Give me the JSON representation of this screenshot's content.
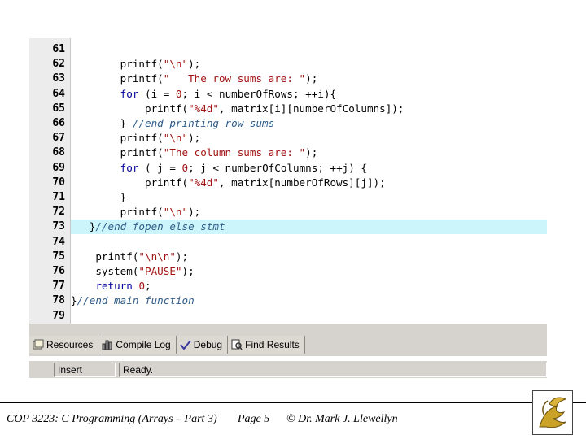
{
  "editor": {
    "lines": [
      {
        "number": "61",
        "tokens": [
          {
            "t": "",
            "c": "tok-punct"
          }
        ]
      },
      {
        "number": "62",
        "tokens": [
          {
            "t": "        printf(",
            "c": "tok-fn"
          },
          {
            "t": "\"\\n\"",
            "c": "tok-str"
          },
          {
            "t": ");",
            "c": "tok-punct"
          }
        ]
      },
      {
        "number": "63",
        "tokens": [
          {
            "t": "        printf(",
            "c": "tok-fn"
          },
          {
            "t": "\"   The row sums are: \"",
            "c": "tok-str"
          },
          {
            "t": ");",
            "c": "tok-punct"
          }
        ]
      },
      {
        "number": "64",
        "tokens": [
          {
            "t": "        ",
            "c": "tok-punct"
          },
          {
            "t": "for",
            "c": "tok-kw"
          },
          {
            "t": " (i = ",
            "c": "tok-punct"
          },
          {
            "t": "0",
            "c": "tok-num"
          },
          {
            "t": "; i < numberOfRows; ++i){",
            "c": "tok-punct"
          }
        ]
      },
      {
        "number": "65",
        "tokens": [
          {
            "t": "            printf(",
            "c": "tok-fn"
          },
          {
            "t": "\"%4d\"",
            "c": "tok-str"
          },
          {
            "t": ", matrix[i][numberOfColumns]);",
            "c": "tok-punct"
          }
        ]
      },
      {
        "number": "66",
        "tokens": [
          {
            "t": "        } ",
            "c": "tok-punct"
          },
          {
            "t": "//end printing row sums",
            "c": "tok-com"
          }
        ]
      },
      {
        "number": "67",
        "tokens": [
          {
            "t": "        printf(",
            "c": "tok-fn"
          },
          {
            "t": "\"\\n\"",
            "c": "tok-str"
          },
          {
            "t": ");",
            "c": "tok-punct"
          }
        ]
      },
      {
        "number": "68",
        "tokens": [
          {
            "t": "        printf(",
            "c": "tok-fn"
          },
          {
            "t": "\"The column sums are: \"",
            "c": "tok-str"
          },
          {
            "t": ");",
            "c": "tok-punct"
          }
        ]
      },
      {
        "number": "69",
        "tokens": [
          {
            "t": "        ",
            "c": "tok-punct"
          },
          {
            "t": "for",
            "c": "tok-kw"
          },
          {
            "t": " ( j = ",
            "c": "tok-punct"
          },
          {
            "t": "0",
            "c": "tok-num"
          },
          {
            "t": "; j < numberOfColumns; ++j) {",
            "c": "tok-punct"
          }
        ]
      },
      {
        "number": "70",
        "tokens": [
          {
            "t": "            printf(",
            "c": "tok-fn"
          },
          {
            "t": "\"%4d\"",
            "c": "tok-str"
          },
          {
            "t": ", matrix[numberOfRows][j]);",
            "c": "tok-punct"
          }
        ]
      },
      {
        "number": "71",
        "tokens": [
          {
            "t": "        }",
            "c": "tok-punct"
          }
        ]
      },
      {
        "number": "72",
        "tokens": [
          {
            "t": "        printf(",
            "c": "tok-fn"
          },
          {
            "t": "\"\\n\"",
            "c": "tok-str"
          },
          {
            "t": ");",
            "c": "tok-punct"
          }
        ]
      },
      {
        "number": "73",
        "highlighted": true,
        "tokens": [
          {
            "t": "   }",
            "c": "tok-punct"
          },
          {
            "t": "//end fopen else stmt",
            "c": "tok-com"
          }
        ]
      },
      {
        "number": "74",
        "tokens": [
          {
            "t": "",
            "c": "tok-punct"
          }
        ]
      },
      {
        "number": "75",
        "tokens": [
          {
            "t": "    printf(",
            "c": "tok-fn"
          },
          {
            "t": "\"\\n\\n\"",
            "c": "tok-str"
          },
          {
            "t": ");",
            "c": "tok-punct"
          }
        ]
      },
      {
        "number": "76",
        "tokens": [
          {
            "t": "    system(",
            "c": "tok-fn"
          },
          {
            "t": "\"PAUSE\"",
            "c": "tok-str"
          },
          {
            "t": ");",
            "c": "tok-punct"
          }
        ]
      },
      {
        "number": "77",
        "tokens": [
          {
            "t": "    ",
            "c": "tok-punct"
          },
          {
            "t": "return",
            "c": "tok-kw"
          },
          {
            "t": " ",
            "c": "tok-punct"
          },
          {
            "t": "0",
            "c": "tok-num"
          },
          {
            "t": ";",
            "c": "tok-punct"
          }
        ]
      },
      {
        "number": "78",
        "tokens": [
          {
            "t": "}",
            "c": "tok-punct"
          },
          {
            "t": "//end main function",
            "c": "tok-com"
          }
        ]
      },
      {
        "number": "79",
        "tokens": [
          {
            "t": "",
            "c": "tok-punct"
          }
        ]
      }
    ],
    "highlight_color": "#ccf5fb"
  },
  "bottom_tabs": [
    {
      "label": "Resources",
      "icon": "resources-icon"
    },
    {
      "label": "Compile Log",
      "icon": "compile-log-icon"
    },
    {
      "label": "Debug",
      "icon": "debug-icon"
    },
    {
      "label": "Find Results",
      "icon": "find-results-icon"
    }
  ],
  "status_bar": {
    "mode": "Insert",
    "status": "Ready."
  },
  "footer": {
    "course": "COP 3223: C Programming (Arrays – Part 3)",
    "page": "Page 5",
    "author": "© Dr. Mark J. Llewellyn"
  }
}
